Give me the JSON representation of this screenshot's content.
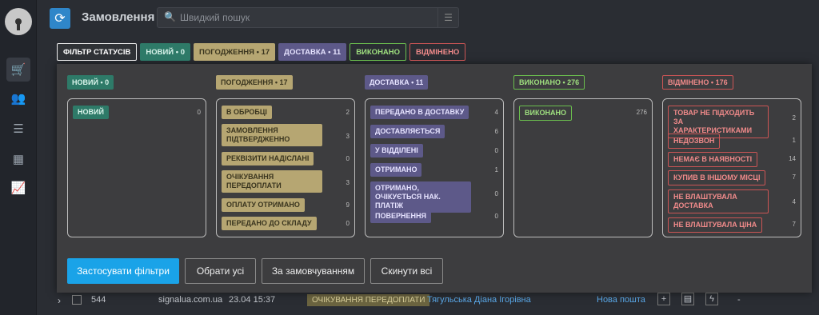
{
  "header": {
    "title": "Замовлення",
    "search_placeholder": "Швидкий пошук"
  },
  "filterbar": {
    "main": "ФІЛЬТР СТАТУСІВ",
    "chips": [
      {
        "label": "НОВИЙ • 0"
      },
      {
        "label": "ПОГОДЖЕННЯ • 17"
      },
      {
        "label": "ДОСТАВКА • 11"
      },
      {
        "label": "ВИКОНАНО"
      },
      {
        "label": "ВІДМІНЕНО"
      }
    ]
  },
  "columns": [
    {
      "head": "НОВИЙ • 0",
      "items": [
        {
          "label": "НОВИЙ",
          "count": "0"
        }
      ]
    },
    {
      "head": "ПОГОДЖЕННЯ • 17",
      "items": [
        {
          "label": "В ОБРОБЦІ",
          "count": "2"
        },
        {
          "label": "ЗАМОВЛЕННЯ ПІДТВЕРДЖЕННО",
          "count": "3"
        },
        {
          "label": "РЕКВІЗИТИ НАДІСЛАНІ",
          "count": "0"
        },
        {
          "label": "ОЧІКУВАННЯ ПЕРЕДОПЛАТИ",
          "count": "3"
        },
        {
          "label": "ОПЛАТУ ОТРИМАНО",
          "count": "9"
        },
        {
          "label": "ПЕРЕДАНО ДО СКЛАДУ",
          "count": "0"
        }
      ]
    },
    {
      "head": "ДОСТАВКА • 11",
      "items": [
        {
          "label": "ПЕРЕДАНО В ДОСТАВКУ",
          "count": "4"
        },
        {
          "label": "ДОСТАВЛЯЄТЬСЯ",
          "count": "6"
        },
        {
          "label": "У ВІДДІЛЕНІ",
          "count": "0"
        },
        {
          "label": "ОТРИМАНО",
          "count": "1"
        },
        {
          "label": "ОТРИМАНО, ОЧІКУЄТЬСЯ НАК. ПЛАТІЖ",
          "count": "0"
        },
        {
          "label": "ПОВЕРНЕННЯ",
          "count": "0"
        }
      ]
    },
    {
      "head": "ВИКОНАНО • 276",
      "items": [
        {
          "label": "ВИКОНАНО",
          "count": "276"
        }
      ]
    },
    {
      "head": "ВІДМІНЕНО • 176",
      "items": [
        {
          "label": "ТОВАР НЕ ПІДХОДИТЬ ЗА ХАРАКТЕРИСТИКАМИ",
          "count": "2"
        },
        {
          "label": "НЕДОЗВОН",
          "count": "1"
        },
        {
          "label": "НЕМАЄ В НАЯВНОСТІ",
          "count": "14"
        },
        {
          "label": "КУПИВ В ІНШОМУ МІСЦІ",
          "count": "7"
        },
        {
          "label": "НЕ ВЛАШТУВАЛА ДОСТАВКА",
          "count": "4"
        },
        {
          "label": "НЕ ВЛАШТУВАЛА ЦІНА",
          "count": "7"
        }
      ]
    }
  ],
  "buttons": {
    "apply": "Застосувати фільтри",
    "select_all": "Обрати усі",
    "default": "За замовчуванням",
    "reset": "Скинути всі"
  },
  "bg_row": {
    "id": "544",
    "site": "signalua.com.ua",
    "date": "23.04 15:37",
    "status": "ОЧІКУВАННЯ ПЕРЕДОПЛАТИ",
    "client": "Тягульська Діана Ігорівна",
    "delivery": "Нова пошта",
    "dash": "-"
  }
}
